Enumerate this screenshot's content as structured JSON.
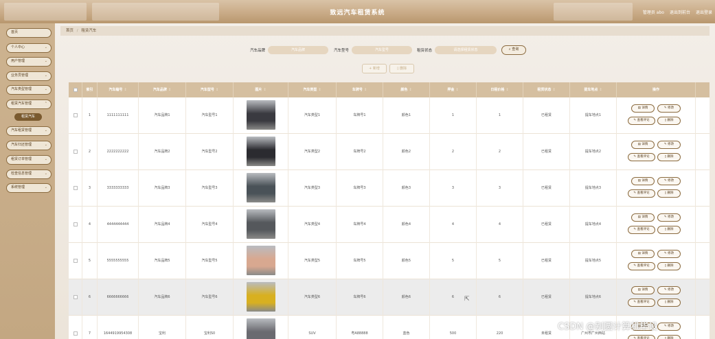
{
  "header": {
    "title": "致远汽车租赁系统",
    "user": "管理员 abo",
    "back_front": "退出到前台",
    "logout": "退出登录"
  },
  "sidebar": {
    "items": [
      {
        "label": "首页",
        "chevron": false
      },
      {
        "label": "个人中心",
        "chevron": true
      },
      {
        "label": "用户管理",
        "chevron": true
      },
      {
        "label": "业务员管理",
        "chevron": true
      },
      {
        "label": "汽车类型管理",
        "chevron": true
      },
      {
        "label": "租赁汽车管理",
        "chevron": true
      },
      {
        "label": "汽车租赁管理",
        "chevron": true
      },
      {
        "label": "汽车归还管理",
        "chevron": true
      },
      {
        "label": "租赁订单管理",
        "chevron": true
      },
      {
        "label": "检查信息管理",
        "chevron": true
      },
      {
        "label": "系统管理",
        "chevron": true
      }
    ],
    "active_sub": "租赁汽车"
  },
  "breadcrumb": {
    "home": "首页",
    "sep": "/",
    "current": "租赁汽车"
  },
  "search": {
    "brand_label": "汽车品牌",
    "brand_placeholder": "汽车品牌",
    "model_label": "汽车型号",
    "model_placeholder": "汽车型号",
    "status_label": "租赁状态",
    "status_placeholder": "请选择租赁状态",
    "query_btn": "查询"
  },
  "actions": {
    "add": "新增",
    "delete": "删除"
  },
  "table": {
    "headers": [
      "索引",
      "汽车编号",
      "汽车品牌",
      "汽车型号",
      "图片",
      "汽车类型",
      "车牌号",
      "颜色",
      "押金",
      "日租价格",
      "租赁状态",
      "提车地点",
      "操作"
    ],
    "row_buttons": {
      "detail": "详情",
      "edit": "修改",
      "comments": "查看评论",
      "delete": "删除"
    },
    "rows": [
      {
        "index": "1",
        "code": "1111111111",
        "brand": "汽车品牌1",
        "model": "汽车型号1",
        "type": "汽车类型1",
        "plate": "车牌号1",
        "color": "颜色1",
        "deposit": "1",
        "price": "1",
        "status": "已租赁",
        "place": "提车地点1",
        "car_color": "#3a3a40"
      },
      {
        "index": "2",
        "code": "2222222222",
        "brand": "汽车品牌2",
        "model": "汽车型号2",
        "type": "汽车类型2",
        "plate": "车牌号2",
        "color": "颜色2",
        "deposit": "2",
        "price": "2",
        "status": "已租赁",
        "place": "提车地点2",
        "car_color": "#2b2b30"
      },
      {
        "index": "3",
        "code": "3333333333",
        "brand": "汽车品牌3",
        "model": "汽车型号3",
        "type": "汽车类型3",
        "plate": "车牌号3",
        "color": "颜色3",
        "deposit": "3",
        "price": "3",
        "status": "已租赁",
        "place": "提车地点3",
        "car_color": "#4a5258"
      },
      {
        "index": "4",
        "code": "4444444444",
        "brand": "汽车品牌4",
        "model": "汽车型号4",
        "type": "汽车类型4",
        "plate": "车牌号4",
        "color": "颜色4",
        "deposit": "4",
        "price": "4",
        "status": "已租赁",
        "place": "提车地点4",
        "car_color": "#55585c"
      },
      {
        "index": "5",
        "code": "5555555555",
        "brand": "汽车品牌5",
        "model": "汽车型号5",
        "type": "汽车类型5",
        "plate": "车牌号5",
        "color": "颜色5",
        "deposit": "5",
        "price": "5",
        "status": "已租赁",
        "place": "提车地点5",
        "car_color": "#d8a890"
      },
      {
        "index": "6",
        "code": "6666666666",
        "brand": "汽车品牌6",
        "model": "汽车型号6",
        "type": "汽车类型6",
        "plate": "车牌号6",
        "color": "颜色6",
        "deposit": "6",
        "price": "6",
        "status": "已租赁",
        "place": "提车地点6",
        "car_color": "#d8b020"
      },
      {
        "index": "7",
        "code": "1644919954308",
        "brand": "宝利",
        "model": "宝利S0",
        "type": "SUV",
        "plate": "粤A88888",
        "color": "蓝色",
        "deposit": "500",
        "price": "220",
        "status": "未租赁",
        "place": "广州市广州西站",
        "car_color": "#6a6a70"
      }
    ]
  },
  "watermark": "CSDN @别圆计算机毕设",
  "colors": {
    "accent": "#8a6a3e",
    "header": "#c9ab87",
    "table_head": "#d5bfa0",
    "sidebar": "#c9ad88"
  }
}
